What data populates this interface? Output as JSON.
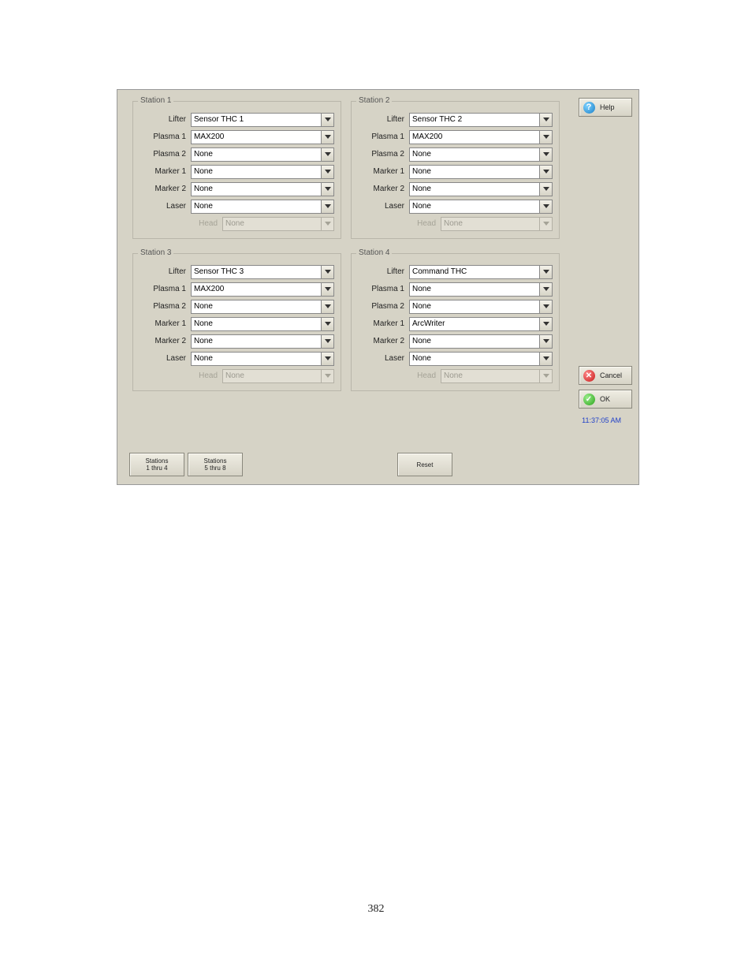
{
  "labels": {
    "lifter": "Lifter",
    "plasma1": "Plasma 1",
    "plasma2": "Plasma 2",
    "marker1": "Marker 1",
    "marker2": "Marker 2",
    "laser": "Laser",
    "head": "Head"
  },
  "stations": [
    {
      "title": "Station 1",
      "lifter": "Sensor THC 1",
      "plasma1": "MAX200",
      "plasma2": "None",
      "marker1": "None",
      "marker2": "None",
      "laser": "None",
      "head": "None"
    },
    {
      "title": "Station 2",
      "lifter": "Sensor THC 2",
      "plasma1": "MAX200",
      "plasma2": "None",
      "marker1": "None",
      "marker2": "None",
      "laser": "None",
      "head": "None"
    },
    {
      "title": "Station 3",
      "lifter": "Sensor THC 3",
      "plasma1": "MAX200",
      "plasma2": "None",
      "marker1": "None",
      "marker2": "None",
      "laser": "None",
      "head": "None"
    },
    {
      "title": "Station 4",
      "lifter": "Command THC",
      "plasma1": "None",
      "plasma2": "None",
      "marker1": "ArcWriter",
      "marker2": "None",
      "laser": "None",
      "head": "None"
    }
  ],
  "time": "11:37:05 AM",
  "buttons": {
    "stations14": "Stations\n1 thru 4",
    "stations58": "Stations\n5 thru 8",
    "reset": "Reset",
    "help": "Help",
    "cancel": "Cancel",
    "ok": "OK"
  },
  "page_number": "382"
}
